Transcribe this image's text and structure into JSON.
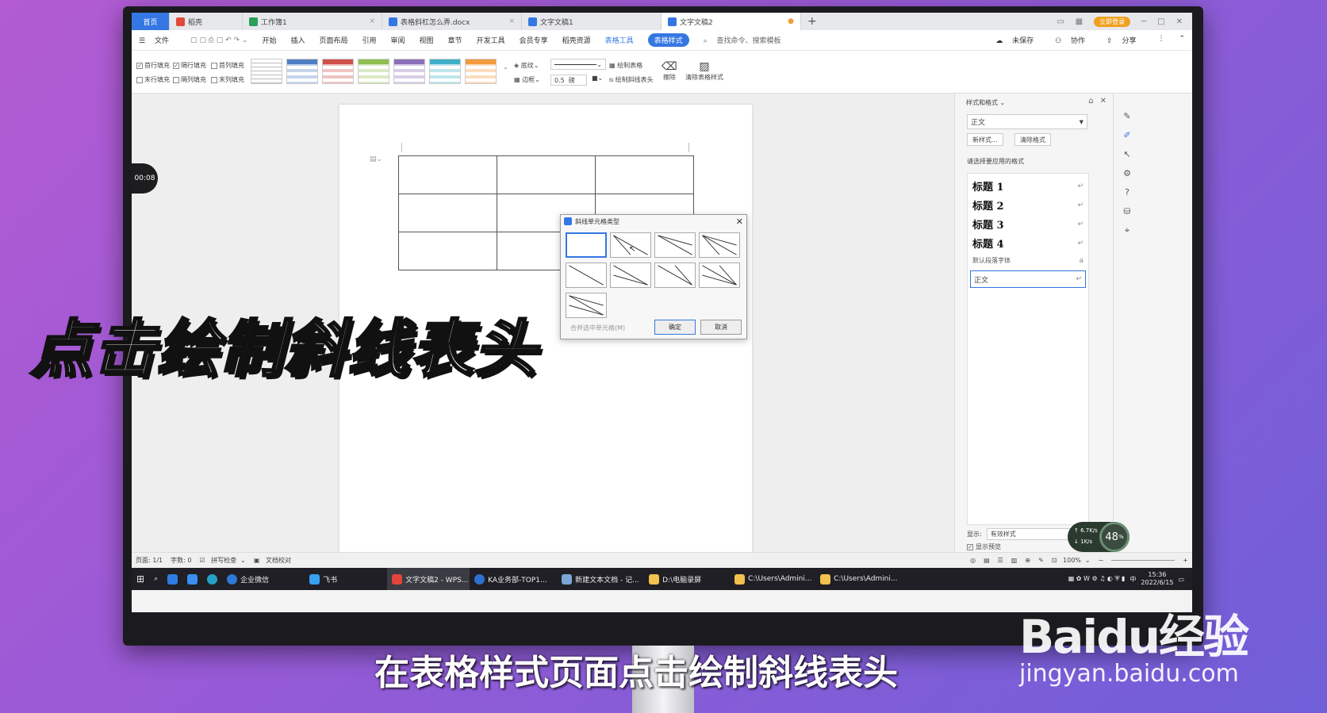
{
  "tabs": [
    {
      "label": "首页"
    },
    {
      "label": "稻壳"
    },
    {
      "label": "工作簿1"
    },
    {
      "label": "表格斜杠怎么弄.docx"
    },
    {
      "label": "文字文稿1"
    },
    {
      "label": "文字文稿2"
    }
  ],
  "header": {
    "login": "立即登录"
  },
  "menu": {
    "file": "文件",
    "items": [
      "开始",
      "插入",
      "页面布局",
      "引用",
      "审阅",
      "视图",
      "章节",
      "开发工具",
      "会员专享",
      "稻壳资源",
      "表格工具",
      "表格样式"
    ],
    "search": "查找命令、搜索模板",
    "unsaved": "未保存",
    "collab": "协作",
    "share": "分享"
  },
  "ribbon": {
    "chk_header_row": "首行填充",
    "chk_banded_rows": "隔行填充",
    "chk_first_col": "首列填充",
    "chk_last_row": "末行填充",
    "chk_banded_cols": "隔列填充",
    "chk_last_col": "末列填充",
    "shading": "底纹",
    "border": "边框",
    "line_width": "0.5",
    "unit": "磅",
    "draw_table": "绘制表格",
    "draw_diagonal": "绘制斜线表头",
    "erase": "擦除",
    "clear_style": "清除表格样式",
    "swatch_colors": [
      "#9a9a9a",
      "#4f7fc4",
      "#d0504a",
      "#8fbf50",
      "#8b6fb8",
      "#3fb0c8",
      "#f29a3c"
    ]
  },
  "timer": "00:08",
  "dialog": {
    "title": "斜线单元格类型",
    "merge_label": "合并选中单元格(M)",
    "ok": "确定",
    "cancel": "取消"
  },
  "taskpane": {
    "title": "样式和格式",
    "current_style": "正文",
    "new_style": "新样式...",
    "clear_format": "清除格式",
    "prompt": "请选择要应用的格式",
    "styles": [
      "标题 1",
      "标题 2",
      "标题 3",
      "标题 4"
    ],
    "default_font": "默认段落字体",
    "normal": "正文",
    "show_label": "显示:",
    "show_value": "有效样式",
    "preview": "显示预览"
  },
  "statusbar": {
    "page": "页面: 1/1",
    "words": "字数: 0",
    "spell": "拼写检查",
    "proof": "文档校对",
    "zoom": "100%"
  },
  "speed": {
    "up": "6.7",
    "down": "1",
    "unit": "K/s",
    "percent": "48",
    "percent_unit": "%"
  },
  "taskbar": [
    {
      "label": "企业微信"
    },
    {
      "label": "飞书"
    },
    {
      "label": "文字文稿2 - WPS..."
    },
    {
      "label": "KA业务部-TOP1..."
    },
    {
      "label": "新建文本文档 - 记..."
    },
    {
      "label": "D:\\电脑录屏"
    },
    {
      "label": "C:\\Users\\Admini..."
    },
    {
      "label": "C:\\Users\\Admini..."
    }
  ],
  "tray": {
    "ime": "中",
    "time": "15:36",
    "date": "2022/6/15"
  },
  "overlay": {
    "title": "点击绘制斜线表头",
    "subtitle": "在表格样式页面点击绘制斜线表头",
    "wm_logo": "Baidu经验",
    "wm_url": "jingyan.baidu.com"
  }
}
